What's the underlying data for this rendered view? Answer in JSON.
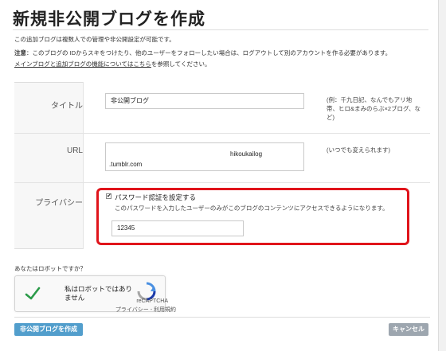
{
  "page": {
    "title": "新規非公開ブログを作成"
  },
  "intro": {
    "line1": "この追加ブログは複数人での管理や非公開設定が可能です。",
    "line2_label": "注意",
    "line2_text": "：このブログの IDからスキをつけたり、他のユーザーをフォローしたい場合は、ログアウトして別のアカウントを作る必要があります。",
    "line3_link": "メインブログと追加ブログの機能についてはこちら",
    "line3_text": "を参照してください。"
  },
  "form": {
    "title_label": "タイトル",
    "title_value": "非公開ブログ",
    "title_hint": "(例：千九日記、なんでもアリ地帯、ヒロ&まみのらぶ×2ブログ、など)",
    "url_label": "URL",
    "url_value": "hikoukailog",
    "url_suffix": ".tumblr.com",
    "url_hint": "(いつでも変えられます)",
    "privacy_label": "プライバシー",
    "password_checkbox_mark": "✔",
    "password_checkbox_label": "パスワード認証を設定する",
    "password_desc": "このパスワードを入力したユーザーのみがこのブログのコンテンツにアクセスできるようになります。",
    "password_value": "12345"
  },
  "captcha": {
    "question": "あなたはロボットですか？",
    "checkbox_text": "私はロボットではありません",
    "brand": "reCAPTCHA",
    "links": "プライバシー - 利用規約"
  },
  "buttons": {
    "create": "非公開ブログを作成",
    "cancel": "キャンセル"
  },
  "colors": {
    "primary_button": "#529ecc",
    "cancel_button": "#9da6af",
    "highlight_box": "#e0141b",
    "captcha_check": "#2b9b49"
  }
}
